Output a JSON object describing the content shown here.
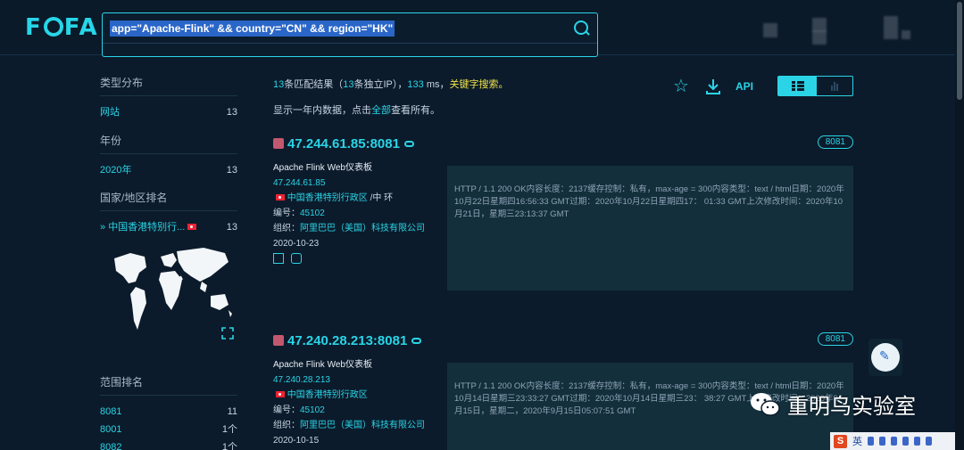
{
  "header": {
    "logo": "FOFA",
    "search": {
      "query_part1": "app=\"Apache-Flink\" && country=\"CN\" && region=\"HK\""
    }
  },
  "sidebar": {
    "type": {
      "title": "类型分布",
      "items": [
        {
          "label": "网站",
          "count": "13"
        }
      ]
    },
    "year": {
      "title": "年份",
      "items": [
        {
          "label": "2020年",
          "count": "13"
        }
      ]
    },
    "country": {
      "title": "国家/地区排名",
      "items": [
        {
          "label": "中国香港特别行...",
          "count": "13"
        }
      ]
    },
    "range": {
      "title": "范围排名",
      "items": [
        {
          "label": "8081",
          "count": "11"
        },
        {
          "label": "8001",
          "count": "1个"
        },
        {
          "label": "8082",
          "count": "1个"
        }
      ]
    }
  },
  "summary": {
    "count": "13",
    "text1": "条匹配结果（",
    "unique": "13",
    "text2": "条独立IP），",
    "ms": "133",
    "text3": " ms，",
    "keyword_link": "关键字搜索。",
    "note_prefix": "显示一年内数据，点击",
    "note_link": "全部",
    "note_suffix": "查看所有。"
  },
  "toolbar": {
    "api_label": "API"
  },
  "results": [
    {
      "host": "47.244.61.85:8081",
      "port": "8081",
      "title": "Apache Flink Web仪表板",
      "ip": "47.244.61.85",
      "region": "中国香港特别行政区",
      "region_extra": "/中 环",
      "asn_label": "编号：",
      "asn": "45102",
      "org_label": "组织：",
      "org": "阿里巴巴（美国）科技有限公司",
      "date": "2020-10-23",
      "banner": "HTTP / 1.1 200 OK内容长度：2137缓存控制：私有，max-age = 300内容类型：text / html日期：2020年10月22日星期四16:56:33 GMT过期：2020年10月22日星期四17： 01:33 GMT上次修改时间：2020年10月21日，星期三23:13:37 GMT"
    },
    {
      "host": "47.240.28.213:8081",
      "port": "8081",
      "title": "Apache Flink Web仪表板",
      "ip": "47.240.28.213",
      "region": "中国香港特别行政区",
      "region_extra": "",
      "asn_label": "编号：",
      "asn": "45102",
      "org_label": "组织：",
      "org": "阿里巴巴（美国）科技有限公司",
      "date": "2020-10-15",
      "banner": "HTTP / 1.1 200 OK内容长度：2137缓存控制：私有，max-age = 300内容类型：text / html日期：2020年10月14日星期三23:33:27 GMT过期：2020年10月14日星期三23： 38:27 GMT上次修改时间：2020年9月15日，星期二，2020年9月15日05:07:51 GMT"
    }
  ],
  "watermark": {
    "text": "重明鸟实验室"
  },
  "ime": {
    "lang": "英"
  },
  "colors": {
    "accent": "#2ad4e6",
    "background": "#0b1b2b",
    "highlight": "#f0e24a"
  }
}
